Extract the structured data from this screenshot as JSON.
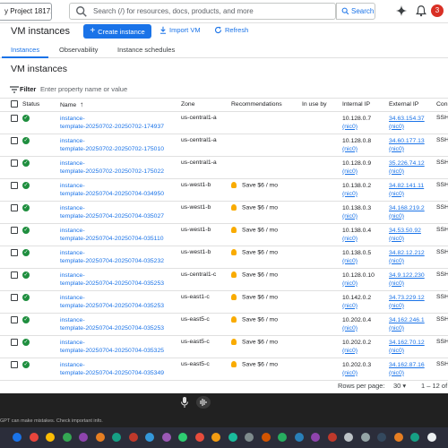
{
  "topbar": {
    "project": "y Project 18171",
    "search_placeholder": "Search (/) for resources, docs, products, and more",
    "search_button": "Search",
    "notification_count": "3"
  },
  "header": {
    "title": "VM instances",
    "create_label": "Create instance",
    "import_label": "Import VM",
    "refresh_label": "Refresh"
  },
  "tabs": [
    "Instances",
    "Observability",
    "Instance schedules"
  ],
  "section_title": "VM instances",
  "filter": {
    "label": "Filter",
    "placeholder": "Enter property name or value"
  },
  "columns": [
    "Status",
    "Name",
    "Zone",
    "Recommendations",
    "In use by",
    "Internal IP",
    "External IP",
    "Conn"
  ],
  "rows": [
    {
      "name1": "instance-",
      "name2": "template-20250702-20250702-174937",
      "zone": "us-central1-a",
      "rec": "",
      "ip": "10.128.0.7",
      "ext": "34.63.154.37",
      "conn": "SSH"
    },
    {
      "name1": "instance-",
      "name2": "template-20250702-20250702-175010",
      "zone": "us-central1-a",
      "rec": "",
      "ip": "10.128.0.8",
      "ext": "34.60.177.13",
      "conn": "SSH"
    },
    {
      "name1": "instance-",
      "name2": "template-20250702-20250702-175022",
      "zone": "us-central1-a",
      "rec": "",
      "ip": "10.128.0.9",
      "ext": "35.226.74.12",
      "conn": "SSH"
    },
    {
      "name1": "instance-",
      "name2": "template-20250704-20250704-034950",
      "zone": "us-west1-b",
      "rec": "Save $6 / mo",
      "ip": "10.138.0.2",
      "ext": "34.82.141.11",
      "conn": "SSH"
    },
    {
      "name1": "instance-",
      "name2": "template-20250704-20250704-035027",
      "zone": "us-west1-b",
      "rec": "Save $6 / mo",
      "ip": "10.138.0.3",
      "ext": "34.168.219.2",
      "conn": "SSH"
    },
    {
      "name1": "instance-",
      "name2": "template-20250704-20250704-035110",
      "zone": "us-west1-b",
      "rec": "Save $6 / mo",
      "ip": "10.138.0.4",
      "ext": "34.53.50.92",
      "conn": "SSH"
    },
    {
      "name1": "instance-",
      "name2": "template-20250704-20250704-035232",
      "zone": "us-west1-b",
      "rec": "Save $6 / mo",
      "ip": "10.138.0.5",
      "ext": "34.82.12.212",
      "conn": "SSH"
    },
    {
      "name1": "instance-",
      "name2": "template-20250704-20250704-035253",
      "zone": "us-central1-c",
      "rec": "Save $6 / mo",
      "ip": "10.128.0.10",
      "ext": "34.9.122.230",
      "conn": "SSH"
    },
    {
      "name1": "instance-",
      "name2": "template-20250704-20250704-035253",
      "zone": "us-east1-c",
      "rec": "Save $6 / mo",
      "ip": "10.142.0.2",
      "ext": "34.73.229.12",
      "conn": "SSH"
    },
    {
      "name1": "instance-",
      "name2": "template-20250704-20250704-035253",
      "zone": "us-east5-c",
      "rec": "Save $6 / mo",
      "ip": "10.202.0.4",
      "ext": "34.162.246.1",
      "conn": "SSH"
    },
    {
      "name1": "instance-",
      "name2": "template-20250704-20250704-035325",
      "zone": "us-east5-c",
      "rec": "Save $6 / mo",
      "ip": "10.202.0.2",
      "ext": "34.162.70.12",
      "conn": "SSH"
    },
    {
      "name1": "instance-",
      "name2": "template-20250704-20250704-035349",
      "zone": "us-east5-c",
      "rec": "Save $6 / mo",
      "ip": "10.202.0.3",
      "ext": "34.162.87.16",
      "conn": "SSH"
    }
  ],
  "nic_label": "(nic0)",
  "pager": {
    "label": "Rows per page:",
    "value": "30",
    "range": "1 – 12 of"
  },
  "chat": {
    "disclaimer": "GPT can make mistakes. Check important info."
  },
  "colors": {
    "accent": "#1a73e8",
    "ok": "#1e8e3e",
    "bulb": "#f9ab00",
    "badge": "#d93025"
  }
}
